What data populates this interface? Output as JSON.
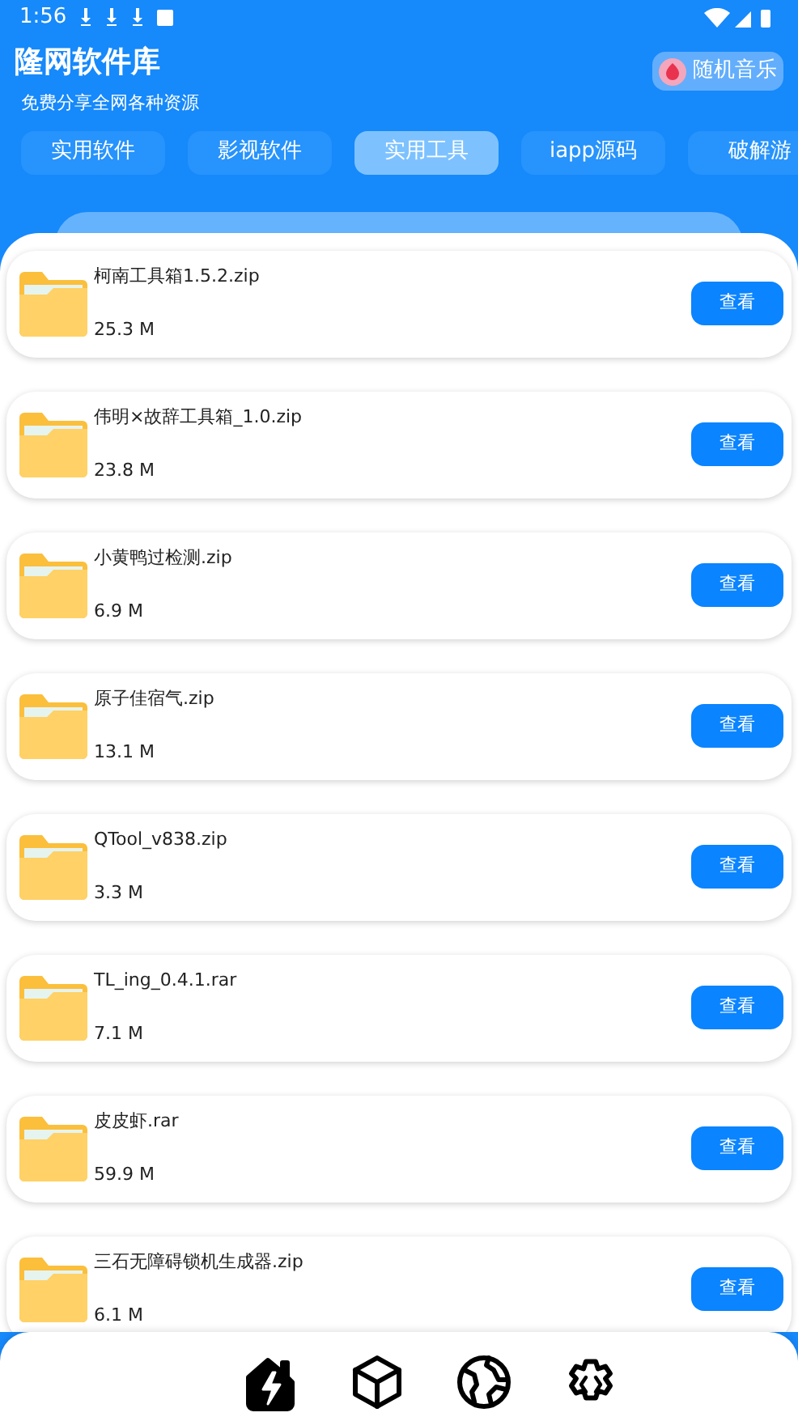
{
  "status_bar": {
    "time": "1:56"
  },
  "header": {
    "title": "隆网软件库",
    "subtitle": "免费分享全网各种资源",
    "music_button": "随机音乐"
  },
  "tabs": [
    {
      "label": "实用软件",
      "selected": false
    },
    {
      "label": "影视软件",
      "selected": false
    },
    {
      "label": "实用工具",
      "selected": true
    },
    {
      "label": "iapp源码",
      "selected": false
    },
    {
      "label": "破解游",
      "selected": false
    }
  ],
  "files": [
    {
      "name": "柯南工具箱1.5.2.zip",
      "size": "25.3 M",
      "action": "查看"
    },
    {
      "name": "伟明×故辞工具箱_1.0.zip",
      "size": "23.8 M",
      "action": "查看"
    },
    {
      "name": "小黄鸭过检测.zip",
      "size": "6.9 M",
      "action": "查看"
    },
    {
      "name": "原子佳宿气.zip",
      "size": "13.1 M",
      "action": "查看"
    },
    {
      "name": "QTool_v838.zip",
      "size": "3.3 M",
      "action": "查看"
    },
    {
      "name": "TL_ing_0.4.1.rar",
      "size": "7.1 M",
      "action": "查看"
    },
    {
      "name": "皮皮虾.rar",
      "size": "59.9 M",
      "action": "查看"
    },
    {
      "name": "三石无障碍锁机生成器.zip",
      "size": "6.1 M",
      "action": "查看"
    }
  ],
  "bottom_nav": [
    {
      "kind": "home",
      "selected": true
    },
    {
      "kind": "box",
      "selected": false
    },
    {
      "kind": "globe",
      "selected": false
    },
    {
      "kind": "gear",
      "selected": false
    }
  ]
}
